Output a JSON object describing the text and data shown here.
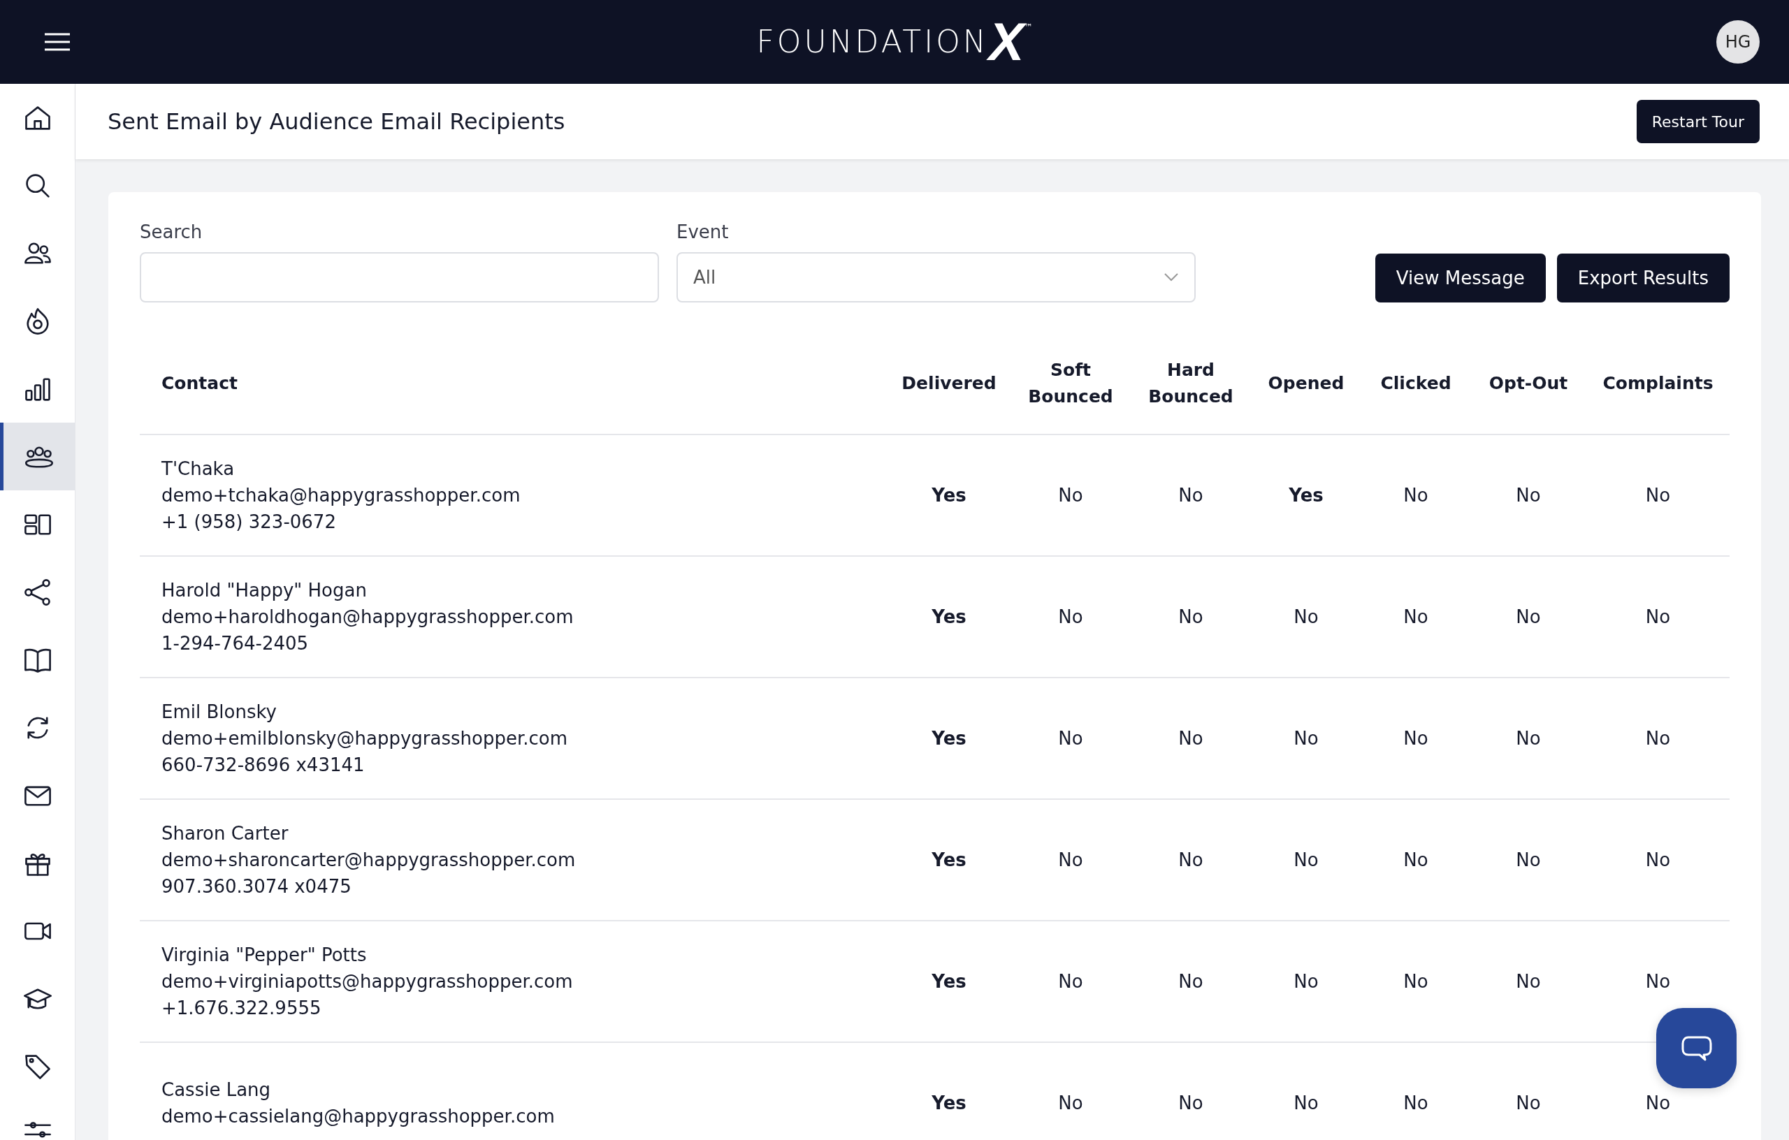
{
  "header": {
    "logo": {
      "text": "FOUNDATION",
      "mark": "X",
      "trademark": "™"
    },
    "avatar": "HG"
  },
  "sidebar": {
    "items": [
      {
        "selected": false
      },
      {
        "selected": false
      },
      {
        "selected": false
      },
      {
        "selected": false
      },
      {
        "selected": false
      },
      {
        "selected": true
      },
      {
        "selected": false
      },
      {
        "selected": false
      },
      {
        "selected": false
      },
      {
        "selected": false
      },
      {
        "selected": false
      },
      {
        "selected": false
      },
      {
        "selected": false
      },
      {
        "selected": false
      },
      {
        "selected": false
      },
      {
        "selected": false
      }
    ]
  },
  "page": {
    "title": "Sent Email by Audience Email Recipients",
    "restart_button": "Restart Tour"
  },
  "filters": {
    "search": {
      "label": "Search"
    },
    "event": {
      "label": "Event",
      "value": "All"
    }
  },
  "buttons": [
    "View Message",
    "Export Results"
  ],
  "table": {
    "columns": [
      "Contact",
      "Delivered",
      "Soft Bounced",
      "Hard Bounced",
      "Opened",
      "Clicked",
      "Opt-Out",
      "Complaints"
    ],
    "rows": [
      {
        "cells": [
          {
            "name": "T'Chaka",
            "email": "demo+tchaka@happygrasshopper.com",
            "phone": "+1 (958) 323-0672"
          },
          {
            "text": "Yes",
            "positive": true
          },
          {
            "text": "No",
            "positive": false
          },
          {
            "text": "No",
            "positive": false
          },
          {
            "text": "Yes",
            "positive": true
          },
          {
            "text": "No",
            "positive": false
          },
          {
            "text": "No",
            "positive": false
          },
          {
            "text": "No",
            "positive": false
          }
        ]
      },
      {
        "cells": [
          {
            "name": "Harold \"Happy\" Hogan",
            "email": "demo+haroldhogan@happygrasshopper.com",
            "phone": "1-294-764-2405"
          },
          {
            "text": "Yes",
            "positive": true
          },
          {
            "text": "No",
            "positive": false
          },
          {
            "text": "No",
            "positive": false
          },
          {
            "text": "No",
            "positive": false
          },
          {
            "text": "No",
            "positive": false
          },
          {
            "text": "No",
            "positive": false
          },
          {
            "text": "No",
            "positive": false
          }
        ]
      },
      {
        "cells": [
          {
            "name": "Emil Blonsky",
            "email": "demo+emilblonsky@happygrasshopper.com",
            "phone": "660-732-8696 x43141"
          },
          {
            "text": "Yes",
            "positive": true
          },
          {
            "text": "No",
            "positive": false
          },
          {
            "text": "No",
            "positive": false
          },
          {
            "text": "No",
            "positive": false
          },
          {
            "text": "No",
            "positive": false
          },
          {
            "text": "No",
            "positive": false
          },
          {
            "text": "No",
            "positive": false
          }
        ]
      },
      {
        "cells": [
          {
            "name": "Sharon Carter",
            "email": "demo+sharoncarter@happygrasshopper.com",
            "phone": "907.360.3074 x0475"
          },
          {
            "text": "Yes",
            "positive": true
          },
          {
            "text": "No",
            "positive": false
          },
          {
            "text": "No",
            "positive": false
          },
          {
            "text": "No",
            "positive": false
          },
          {
            "text": "No",
            "positive": false
          },
          {
            "text": "No",
            "positive": false
          },
          {
            "text": "No",
            "positive": false
          }
        ]
      },
      {
        "cells": [
          {
            "name": "Virginia \"Pepper\" Potts",
            "email": "demo+virginiapotts@happygrasshopper.com",
            "phone": "+1.676.322.9555"
          },
          {
            "text": "Yes",
            "positive": true
          },
          {
            "text": "No",
            "positive": false
          },
          {
            "text": "No",
            "positive": false
          },
          {
            "text": "No",
            "positive": false
          },
          {
            "text": "No",
            "positive": false
          },
          {
            "text": "No",
            "positive": false
          },
          {
            "text": "No",
            "positive": false
          }
        ]
      },
      {
        "cells": [
          {
            "name": "Cassie Lang",
            "email": "demo+cassielang@happygrasshopper.com"
          },
          {
            "text": "Yes",
            "positive": true
          },
          {
            "text": "No",
            "positive": false
          },
          {
            "text": "No",
            "positive": false
          },
          {
            "text": "No",
            "positive": false
          },
          {
            "text": "No",
            "positive": false
          },
          {
            "text": "No",
            "positive": false
          },
          {
            "text": "No",
            "positive": false
          }
        ]
      }
    ]
  }
}
